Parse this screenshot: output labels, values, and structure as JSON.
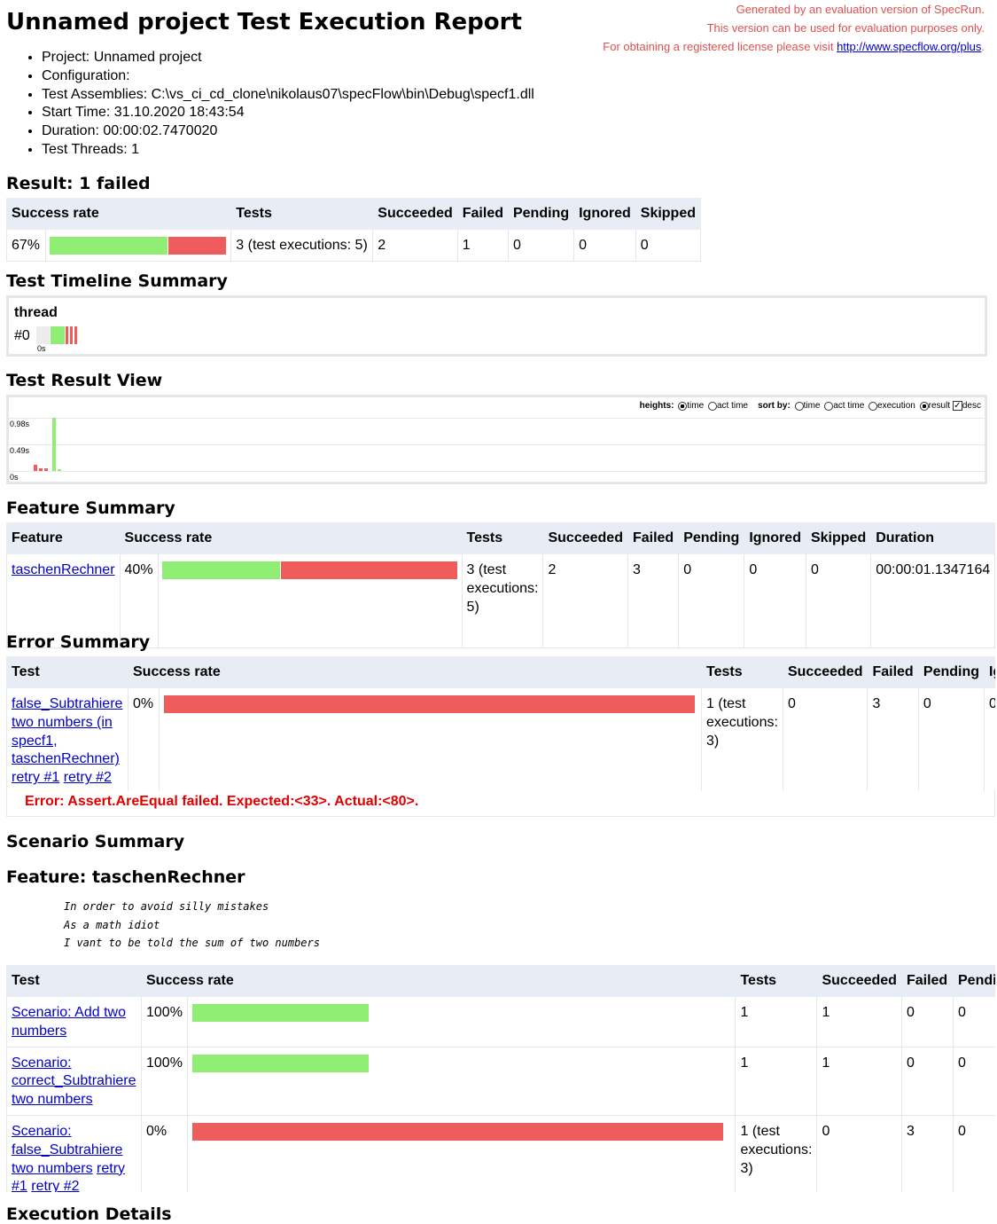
{
  "header": {
    "title": "Unnamed project Test Execution Report",
    "notice_line1": "Generated by an evaluation version of SpecRun.",
    "notice_line2": "This version can be used for evaluation purposes only.",
    "notice_line3_prefix": "For obtaining a registered license please visit ",
    "notice_link": "http://www.specflow.org/plus",
    "notice_suffix": "."
  },
  "info": [
    "Project: Unnamed project",
    "Configuration:",
    "Test Assemblies: C:\\vs_ci_cd_clone\\nikolaus07\\specFlow\\bin\\Debug\\specf1.dll",
    "Start Time: 31.10.2020 18:43:54",
    "Duration: 00:00:02.7470020",
    "Test Threads: 1"
  ],
  "result": {
    "heading": "Result: 1 failed",
    "headers": [
      "Success rate",
      "Tests",
      "Succeeded",
      "Failed",
      "Pending",
      "Ignored",
      "Skipped"
    ],
    "rate": "67%",
    "rate_fraction": 0.67,
    "tests": "3 (test executions: 5)",
    "succeeded": "2",
    "failed": "1",
    "pending": "0",
    "ignored": "0",
    "skipped": "0"
  },
  "timeline": {
    "heading": "Test Timeline Summary",
    "thread_label": "thread",
    "thread_id": "#0",
    "tick": "0s"
  },
  "result_view": {
    "heading": "Test Result View",
    "heights_label": "heights:",
    "heights_options": [
      "time",
      "act time"
    ],
    "heights_selected": "time",
    "sort_label": "sort by:",
    "sort_options": [
      "time",
      "act time",
      "execution",
      "result"
    ],
    "sort_selected": "result",
    "desc_label": "desc",
    "desc_checked": true,
    "y_ticks": [
      "0.98s",
      "0.49s",
      "0s"
    ]
  },
  "feature_summary": {
    "heading": "Feature Summary",
    "headers": [
      "Feature",
      "Success rate",
      "Tests",
      "Succeeded",
      "Failed",
      "Pending",
      "Ignored",
      "Skipped",
      "Duration"
    ],
    "row": {
      "feature": "taschenRechner",
      "rate": "40%",
      "rate_fraction": 0.4,
      "tests": "3 (test executions: 5)",
      "succeeded": "2",
      "failed": "3",
      "pending": "0",
      "ignored": "0",
      "skipped": "0",
      "duration": "00:00:01.1347164"
    }
  },
  "error_summary": {
    "heading": "Error Summary",
    "headers": [
      "Test",
      "Success rate",
      "Tests",
      "Succeeded",
      "Failed",
      "Pending",
      "Ig"
    ],
    "row": {
      "test_link": "false_Subtrahiere two numbers (in specf1, taschenRechner)",
      "retry1": "retry #1",
      "retry2": "retry #2",
      "rate": "0%",
      "rate_fraction": 0,
      "tests": "1 (test executions: 3)",
      "succeeded": "0",
      "failed": "3",
      "pending": "0",
      "ignored": "0"
    },
    "error_message": "Error: Assert.AreEqual failed. Expected:<33>. Actual:<80>."
  },
  "scenario_summary": {
    "heading": "Scenario Summary",
    "feature_heading": "Feature: taschenRechner",
    "description": [
      "In order to avoid silly mistakes",
      "As a math idiot",
      "I vant to be told the sum of two numbers"
    ],
    "headers": [
      "Test",
      "Success rate",
      "Tests",
      "Succeeded",
      "Failed",
      "Pendin"
    ],
    "rows": [
      {
        "name": "Scenario: Add two numbers",
        "rate": "100%",
        "rate_fraction": 1,
        "tests": "1",
        "succeeded": "1",
        "failed": "0",
        "pending": "0"
      },
      {
        "name": "Scenario: correct_Subtrahiere two numbers",
        "rate": "100%",
        "rate_fraction": 1,
        "tests": "1",
        "succeeded": "1",
        "failed": "0",
        "pending": "0"
      },
      {
        "name": "Scenario: false_Subtrahiere two numbers",
        "retry1": "retry #1",
        "retry2": "retry #2",
        "rate": "0%",
        "rate_fraction": 0,
        "tests": "1 (test executions: 3)",
        "succeeded": "0",
        "failed": "3",
        "pending": "0"
      }
    ]
  },
  "execution_details": {
    "heading": "Execution Details"
  },
  "colors": {
    "success": "#90ee74",
    "failure": "#ee5c5c",
    "header_bg": "#e8edf5",
    "error_text": "#e00000",
    "notice_text": "#e05050"
  }
}
